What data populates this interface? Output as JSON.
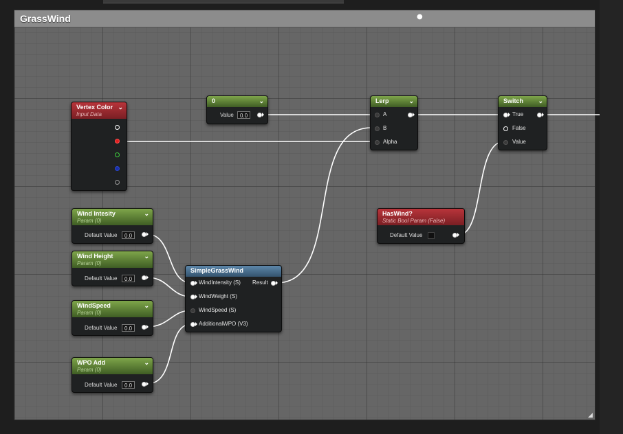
{
  "comment": {
    "title": "GrassWind"
  },
  "nodes": {
    "vertex_color": {
      "title": "Vertex Color",
      "subtitle": "Input Data"
    },
    "constant": {
      "title": "0",
      "value_label": "Value",
      "value": "0.0"
    },
    "lerp": {
      "title": "Lerp",
      "pins": [
        "A",
        "B",
        "Alpha"
      ]
    },
    "switch": {
      "title": "Switch",
      "pins": [
        "True",
        "False",
        "Value"
      ]
    },
    "has_wind": {
      "title": "HasWind?",
      "subtitle": "Static Bool Param (False)",
      "default_label": "Default Value"
    },
    "wind_intensity": {
      "title": "Wind Intesity",
      "subtitle": "Param (0)",
      "default_label": "Default Value",
      "value": "0.0"
    },
    "wind_height": {
      "title": "Wind Height",
      "subtitle": "Param (0)",
      "default_label": "Default Value",
      "value": "0.0"
    },
    "wind_speed": {
      "title": "WindSpeed",
      "subtitle": "Param (0)",
      "default_label": "Default Value",
      "value": "0.0"
    },
    "wpo_add": {
      "title": "WPO Add",
      "subtitle": "Param (0)",
      "default_label": "Default Value",
      "value": "0.0"
    },
    "simple_grass_wind": {
      "title": "SimpleGrassWind",
      "inputs": [
        "WindIntensity (S)",
        "WindWeight (S)",
        "WindSpeed (S)",
        "AdditionalWPO (V3)"
      ],
      "output": "Result"
    }
  },
  "colors": {
    "graph_bg": "#666666",
    "header_red": "#b8343a",
    "header_green": "#7ea54a",
    "header_blue": "#5d87aa",
    "wire": "#ffffff"
  }
}
